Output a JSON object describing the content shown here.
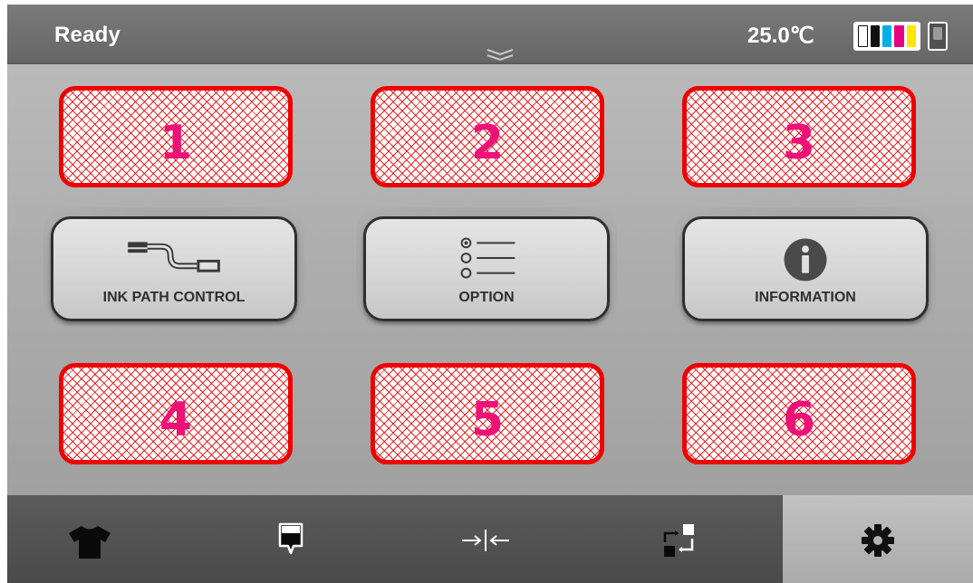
{
  "status": {
    "text": "Ready",
    "temperature": "25.0℃"
  },
  "ink": [
    "#ffffff",
    "#111111",
    "#00aee8",
    "#e6007e",
    "#ffe600"
  ],
  "redactions": [
    "1",
    "2",
    "3",
    "4",
    "5",
    "6"
  ],
  "menu": {
    "ink_path_control": "INK PATH CONTROL",
    "option": "OPTION",
    "information": "INFORMATION"
  },
  "icons": {
    "expand": "double-chevron-down-icon",
    "ink_path": "ink-tube-icon",
    "option": "radio-list-icon",
    "info": "info-circle-icon",
    "nav": [
      "t-shirt-icon",
      "platen-icon",
      "gap-adjust-icon",
      "transfer-icon",
      "gear-icon"
    ]
  },
  "colors": {
    "redaction_border": "#ee0000",
    "redaction_number": "#ee1177",
    "button_border": "#2f2f2f"
  }
}
